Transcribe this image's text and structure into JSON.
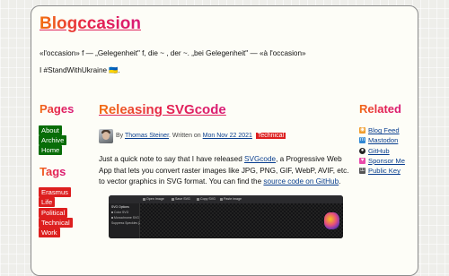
{
  "site": {
    "title": "Blogccasion",
    "tagline": "«l'occasion» f — „Gelegenheit\" f, die ~ , der ~. „bei Gelegenheit\" — «à l'occasion»",
    "ukraine_line": "I #StandWithUkraine 🇺🇦."
  },
  "sidebar_left": {
    "pages_heading": "Pages",
    "pages": [
      "About",
      "Archive",
      "Home"
    ],
    "tags_heading": "Tags",
    "tags": [
      "Erasmus",
      "Life",
      "Political",
      "Technical",
      "Work"
    ]
  },
  "post": {
    "title": "Releasing SVGcode",
    "byline_by": "By",
    "author": "Thomas Steiner",
    "byline_written": ". Written on",
    "date": "Mon Nov 22 2021",
    "tag": "Technical",
    "intro_1": "Just a quick note to say that I have released ",
    "intro_link1": "SVGcode",
    "intro_2": ", a Progressive Web App that lets you convert raster images like JPG, PNG, GIF, WebP, AVIF, etc. to vector graphics in SVG format. You can find the ",
    "intro_link2": "source code on GitHub",
    "intro_3": "."
  },
  "sidebar_right": {
    "heading": "Related",
    "items": [
      {
        "label": "Blog Feed",
        "icon": "rss-icon"
      },
      {
        "label": "Mastodon",
        "icon": "mastodon-icon"
      },
      {
        "label": "GitHub",
        "icon": "github-icon"
      },
      {
        "label": "Sponsor Me",
        "icon": "heart-icon"
      },
      {
        "label": "Public Key",
        "icon": "key-icon"
      }
    ]
  },
  "screenshot": {
    "toolbar": [
      "Open Image",
      "Save SVG",
      "Copy SVG",
      "Paste image"
    ],
    "panel": [
      "SVG Options",
      "Color SVG",
      "Monochrome SVG",
      "Suppress Speckles (2 Pixels)"
    ]
  },
  "colors": {
    "accent_orange": "#f26f0f",
    "accent_pink": "#e5224c",
    "nav_green": "#086d08",
    "tag_red": "#dd1f1f",
    "link_blue": "#0a3f8f"
  }
}
